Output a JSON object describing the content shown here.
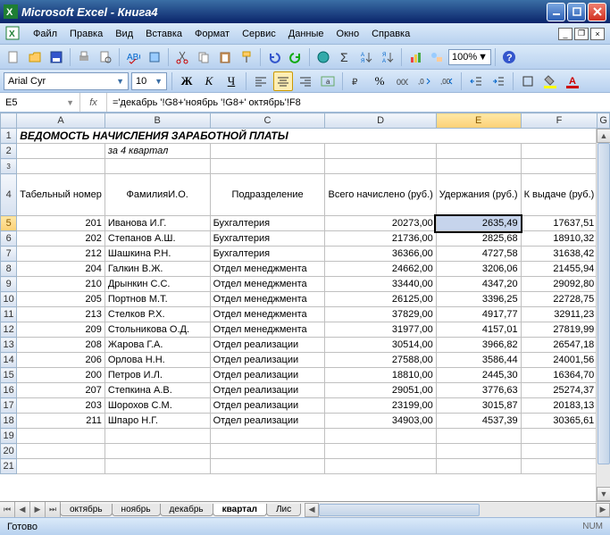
{
  "app": {
    "title": "Microsoft Excel - Книга4"
  },
  "menu": {
    "file": "Файл",
    "edit": "Правка",
    "view": "Вид",
    "insert": "Вставка",
    "format": "Формат",
    "tools": "Сервис",
    "data": "Данные",
    "window": "Окно",
    "help": "Справка"
  },
  "toolbar": {
    "zoom": "100%"
  },
  "format_bar": {
    "font": "Arial Cyr",
    "size": "10"
  },
  "formula": {
    "cell_ref": "E5",
    "fx": "fx",
    "content": "='декабрь '!G8+'ноябрь '!G8+' октябрь'!F8"
  },
  "columns": [
    "A",
    "B",
    "C",
    "D",
    "E",
    "F",
    "G"
  ],
  "rows_header": [
    "1",
    "2",
    "3",
    "4",
    "5",
    "6",
    "7",
    "8",
    "9",
    "10",
    "11",
    "12",
    "13",
    "14",
    "15",
    "16",
    "17",
    "18",
    "19",
    "20",
    "21"
  ],
  "sheet": {
    "title": "ВЕДОМОСТЬ НАЧИСЛЕНИЯ ЗАРАБОТНОЙ ПЛАТЫ",
    "subtitle": "за 4 квартал",
    "headers": {
      "tab_no": "Табельный номер",
      "fio": "ФамилияИ.О.",
      "dep": "Подразделение",
      "total": "Всего начислено (руб.)",
      "ded": "Удержания (руб.)",
      "pay": "К выдаче (руб.)"
    },
    "rows": [
      {
        "n": "201",
        "f": "Иванова И.Г.",
        "d": "Бухгалтерия",
        "t": "20273,00",
        "u": "2635,49",
        "p": "17637,51"
      },
      {
        "n": "202",
        "f": "Степанов А.Ш.",
        "d": "Бухгалтерия",
        "t": "21736,00",
        "u": "2825,68",
        "p": "18910,32"
      },
      {
        "n": "212",
        "f": "Шашкина Р.Н.",
        "d": "Бухгалтерия",
        "t": "36366,00",
        "u": "4727,58",
        "p": "31638,42"
      },
      {
        "n": "204",
        "f": "Галкин В.Ж.",
        "d": "Отдел менеджмента",
        "t": "24662,00",
        "u": "3206,06",
        "p": "21455,94"
      },
      {
        "n": "210",
        "f": "Дрынкин С.С.",
        "d": "Отдел менеджмента",
        "t": "33440,00",
        "u": "4347,20",
        "p": "29092,80"
      },
      {
        "n": "205",
        "f": "Портнов М.Т.",
        "d": "Отдел менеджмента",
        "t": "26125,00",
        "u": "3396,25",
        "p": "22728,75"
      },
      {
        "n": "213",
        "f": "Стелков Р.Х.",
        "d": "Отдел менеджмента",
        "t": "37829,00",
        "u": "4917,77",
        "p": "32911,23"
      },
      {
        "n": "209",
        "f": "Стольникова О.Д.",
        "d": "Отдел менеджмента",
        "t": "31977,00",
        "u": "4157,01",
        "p": "27819,99"
      },
      {
        "n": "208",
        "f": "Жарова Г.А.",
        "d": "Отдел реализации",
        "t": "30514,00",
        "u": "3966,82",
        "p": "26547,18"
      },
      {
        "n": "206",
        "f": "Орлова Н.Н.",
        "d": "Отдел реализации",
        "t": "27588,00",
        "u": "3586,44",
        "p": "24001,56"
      },
      {
        "n": "200",
        "f": "Петров И.Л.",
        "d": "Отдел реализации",
        "t": "18810,00",
        "u": "2445,30",
        "p": "16364,70"
      },
      {
        "n": "207",
        "f": "Степкина А.В.",
        "d": "Отдел реализации",
        "t": "29051,00",
        "u": "3776,63",
        "p": "25274,37"
      },
      {
        "n": "203",
        "f": "Шорохов С.М.",
        "d": "Отдел реализации",
        "t": "23199,00",
        "u": "3015,87",
        "p": "20183,13"
      },
      {
        "n": "211",
        "f": "Шпаро Н.Г.",
        "d": "Отдел реализации",
        "t": "34903,00",
        "u": "4537,39",
        "p": "30365,61"
      }
    ]
  },
  "tabs": {
    "t1": "октябрь",
    "t2": "ноябрь",
    "t3": "декабрь",
    "t4": "квартал",
    "t5": "Лис"
  },
  "status": {
    "ready": "Готово",
    "num": "NUM"
  }
}
